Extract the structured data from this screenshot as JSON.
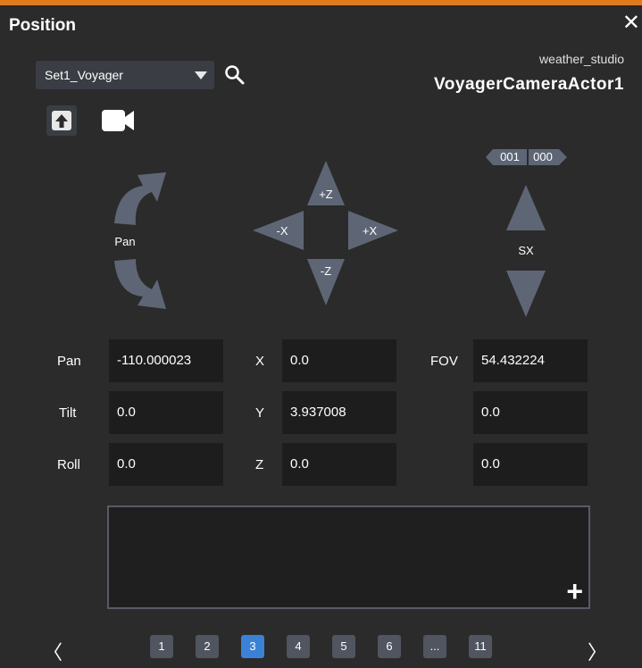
{
  "header": {
    "title": "Position",
    "close_glyph": "✕"
  },
  "set_select": {
    "value": "Set1_Voyager"
  },
  "target": {
    "studio": "weather_studio",
    "actor": "VoyagerCameraActor1"
  },
  "toolbar": {
    "icons": [
      "upload-icon",
      "camera-icon",
      "search-icon"
    ]
  },
  "controls": {
    "pan_label": "Pan",
    "plus_z": "+Z",
    "minus_z": "-Z",
    "minus_x": "-X",
    "plus_x": "+X",
    "zoom_counter_a": "001",
    "zoom_counter_b": "000",
    "sx_label": "SX"
  },
  "rotation": {
    "pan": {
      "label": "Pan",
      "value": "-110.000023"
    },
    "tilt": {
      "label": "Tilt",
      "value": "0.0"
    },
    "roll": {
      "label": "Roll",
      "value": "0.0"
    }
  },
  "location": {
    "x": {
      "label": "X",
      "value": "0.0"
    },
    "y": {
      "label": "Y",
      "value": "3.937008"
    },
    "z": {
      "label": "Z",
      "value": "0.0"
    }
  },
  "lens": {
    "fov": {
      "label": "FOV",
      "value": "54.432224"
    },
    "row2": {
      "value": "0.0"
    },
    "row3": {
      "value": "0.0"
    }
  },
  "notes": {
    "add_glyph": "+"
  },
  "pager": {
    "prev": "〈",
    "next": "〉",
    "pages": [
      "1",
      "2",
      "3",
      "4",
      "5",
      "6",
      "...",
      "11"
    ],
    "active": "3"
  },
  "colors": {
    "accent": "#e07a1f",
    "active_page": "#3b82d6",
    "control": "#5e6675",
    "field_bg": "#1d1d1d"
  }
}
